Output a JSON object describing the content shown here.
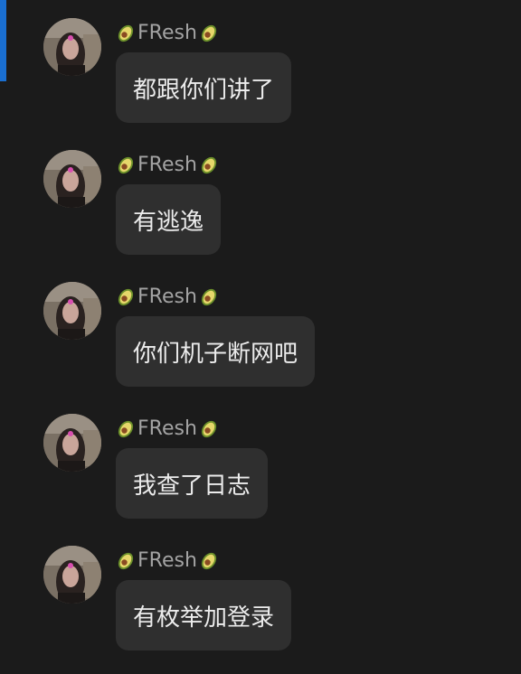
{
  "messages": [
    {
      "sender": "FResh",
      "text": "都跟你们讲了"
    },
    {
      "sender": "FResh",
      "text": "有逃逸"
    },
    {
      "sender": "FResh",
      "text": "你们机子断网吧"
    },
    {
      "sender": "FResh",
      "text": "我查了日志"
    },
    {
      "sender": "FResh",
      "text": "有枚举加登录"
    }
  ],
  "icons": {
    "sender_badge": "avocado-icon",
    "avatar": "user-avatar-photo"
  },
  "colors": {
    "background": "#1b1b1b",
    "bubble": "#2f2f2f",
    "text": "#ececec",
    "sender": "#a3a3a3",
    "accent": "#1a6fd1"
  }
}
